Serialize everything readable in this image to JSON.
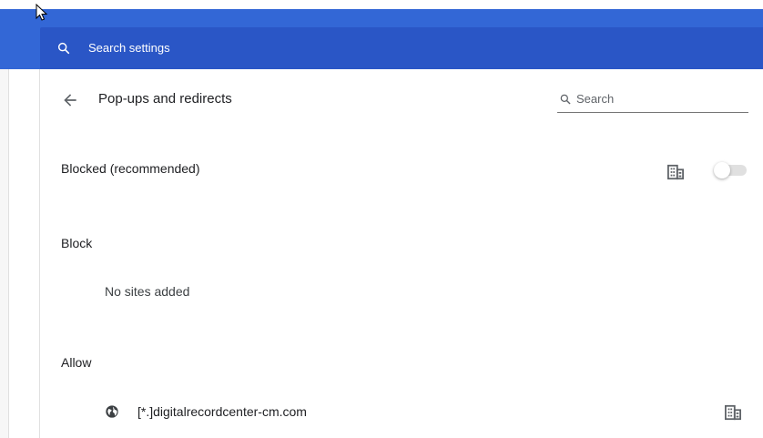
{
  "header": {
    "search_placeholder": "Search settings"
  },
  "page": {
    "title": "Pop-ups and redirects",
    "search_label": "Search"
  },
  "blocked_row": {
    "label": "Blocked (recommended)",
    "toggle_on": false
  },
  "block_section": {
    "heading": "Block",
    "empty_message": "No sites added"
  },
  "allow_section": {
    "heading": "Allow",
    "sites": [
      {
        "site": "[*.]digitalrecordcenter-cm.com"
      }
    ]
  },
  "colors": {
    "header": "#3367d6",
    "searchbar": "#2a56c6"
  },
  "icons": [
    "search-icon",
    "back-arrow-icon",
    "enterprise-policy-icon",
    "globe-icon",
    "cursor-icon"
  ]
}
